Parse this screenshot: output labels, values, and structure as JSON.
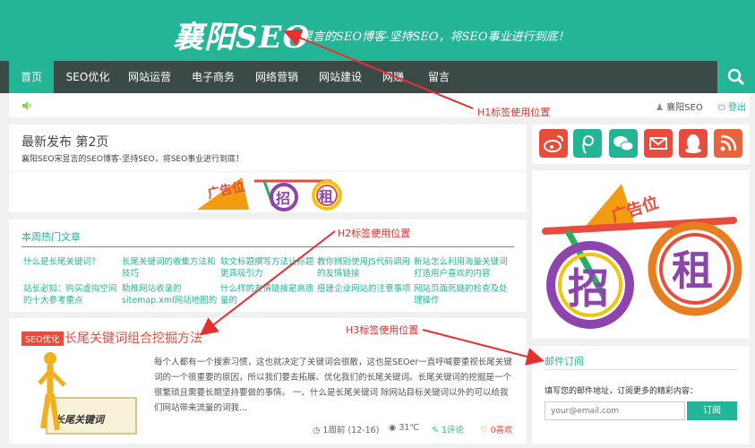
{
  "header": {
    "logo_text": "襄阳SEO",
    "tagline": "宋昱言的SEO博客-坚持SEO，将SEO事业进行到底！"
  },
  "nav": {
    "items": [
      {
        "label": "首页",
        "active": true
      },
      {
        "label": "SEO优化"
      },
      {
        "label": "网站运营"
      },
      {
        "label": "电子商务"
      },
      {
        "label": "网络营销"
      },
      {
        "label": "网站建设"
      },
      {
        "label": "网赚"
      },
      {
        "label": "留言"
      }
    ],
    "search_icon": "search-icon"
  },
  "topbar": {
    "user": "襄阳SEO",
    "logout": "登出"
  },
  "latest": {
    "title": "最新发布 第2页",
    "subtitle": "襄阳SEO宋昱言的SEO博客-坚持SEO，将SEO事业进行到底！"
  },
  "banner": {
    "text_ad": "广告位",
    "text_zhao": "招",
    "text_zu": "租"
  },
  "hot": {
    "title": "本周热门文章",
    "articles": [
      "什么是长尾关键词？",
      "长尾关键词的收集方法和技巧",
      "软文标题撰写方法让标题更具吸引力",
      "教你辨别使用JS代码调用的友情链接",
      "新站怎么利用海量关键词打造用户喜欢的内容",
      "站长必知：购买虚拟空间的十大参考重点",
      "助推网站收录的sitemap.xml网站地图的",
      "什么样的友情链接是高质量的",
      "搭建企业网站的注意事项",
      "网站页面死链的检查及处理操作"
    ]
  },
  "post": {
    "tag": "SEO优化",
    "title": "长尾关键词组合挖掘方法",
    "excerpt": "每个人都有一个搜索习惯，这也就决定了关键词会很散，这也是SEOer一直呼喊要重视长尾关键词的一个很重要的原因，所以我们要去拓展、优化我们的长尾关键词。长尾关键词的挖掘是一个很繁琐且需要长期坚持要做的事情。 一、什么是长尾关键词 除网站目标关键词以外的可以给我们网站带来流量的词我...",
    "thumb_text": "长尾关键词",
    "meta": {
      "time": "1周前 (12-16)",
      "views": "31℃",
      "comments": "1评论",
      "likes": "0喜欢"
    }
  },
  "sidebar": {
    "social": [
      {
        "icon": "weibo-icon",
        "color": "#e74c3c"
      },
      {
        "icon": "tencent-weibo-icon",
        "color": "#23b596"
      },
      {
        "icon": "wechat-icon",
        "color": "#23b596"
      },
      {
        "icon": "email-icon",
        "color": "#e74c3c"
      },
      {
        "icon": "qq-icon",
        "color": "#e74c3c"
      },
      {
        "icon": "rss-icon",
        "color": "#e8643c"
      }
    ],
    "subscribe": {
      "title": "邮件订阅",
      "desc": "填写您的邮件地址，订阅更多的精彩内容：",
      "placeholder": "your@email.com",
      "button": "订阅"
    }
  },
  "annotations": {
    "h1": "H1标签使用位置",
    "h2": "H2标签使用位置",
    "h3": "H3标签使用位置"
  },
  "colors": {
    "brand": "#23b596",
    "nav_bg": "#3b4a46",
    "accent_red": "#e74c3c",
    "annotation": "#e63030"
  }
}
